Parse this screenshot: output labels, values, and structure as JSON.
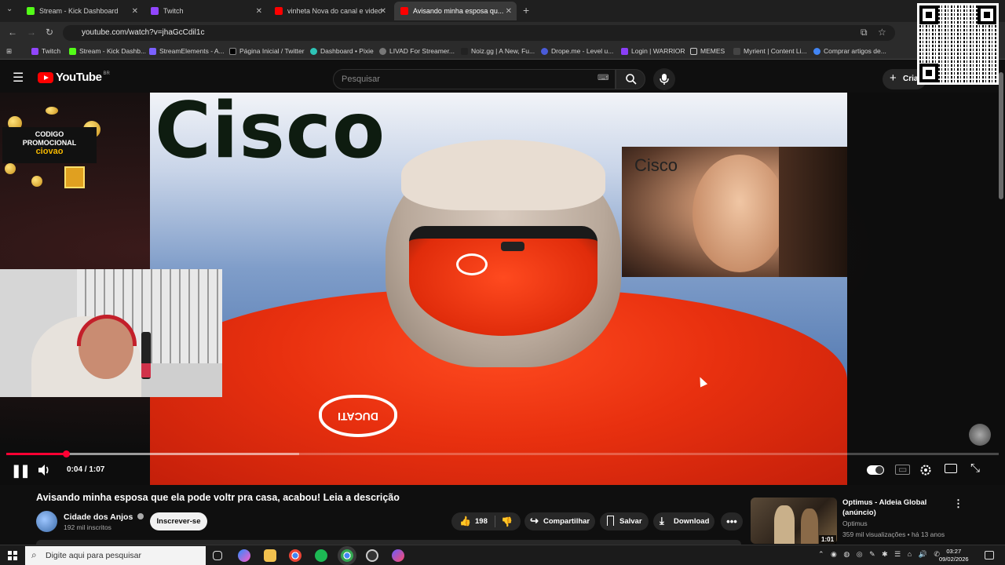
{
  "browser": {
    "tabs": [
      {
        "label": "Stream - Kick Dashboard",
        "color": "#53fc18"
      },
      {
        "label": "Twitch",
        "color": "#9146ff"
      },
      {
        "label": "vinheta Nova do canal e video",
        "color": "#ff0000"
      },
      {
        "label": "Avisando minha esposa qu...",
        "color": "#ff0000"
      }
    ],
    "url": "youtube.com/watch?v=jhaGcCdil1c",
    "bookmarks": [
      "Twitch",
      "Stream - Kick Dashb...",
      "StreamElements - A...",
      "Página Inicial / Twitter",
      "Dashboard • Pixie",
      "LIVAD For Streamer...",
      "Noiz.gg | A New, Fu...",
      "Drope.me - Level u...",
      "Login | WARRIOR",
      "MEMES",
      "Myrient | Content Li...",
      "Comprar artigos de..."
    ]
  },
  "youtube": {
    "logo": "YouTube",
    "region": "BR",
    "search_placeholder": "Pesquisar",
    "create_label": "Cria"
  },
  "video": {
    "overlay_title": "Cisco",
    "inset_label": "Cisco",
    "promo_line1": "CODIGO",
    "promo_line2": "PROMOCIONAL",
    "promo_code": "ciovao",
    "time": "0:04 / 1:07",
    "progress_fraction": 0.06,
    "buffered_fraction": 0.295,
    "hoodie_text": "DUCATI"
  },
  "info": {
    "title": "Avisando minha esposa que ela pode voltr pra casa, acabou! Leia a descrição",
    "channel": "Cidade dos Anjos",
    "subscribers": "192 mil inscritos",
    "subscribe": "Inscrever-se",
    "likes": "198",
    "share": "Compartilhar",
    "save": "Salvar",
    "download": "Download"
  },
  "recommended": {
    "title": "Optimus - Aldeia Global (anúncio)",
    "channel": "Optimus",
    "meta": "359 mil visualizações • há 13 anos",
    "duration": "1:01"
  },
  "taskbar": {
    "search_placeholder": "Digite aqui para pesquisar",
    "time": "03:27",
    "date": "09/02/2026"
  },
  "colors": {
    "accent": "#ff0033",
    "youtube_red": "#ff0000"
  }
}
